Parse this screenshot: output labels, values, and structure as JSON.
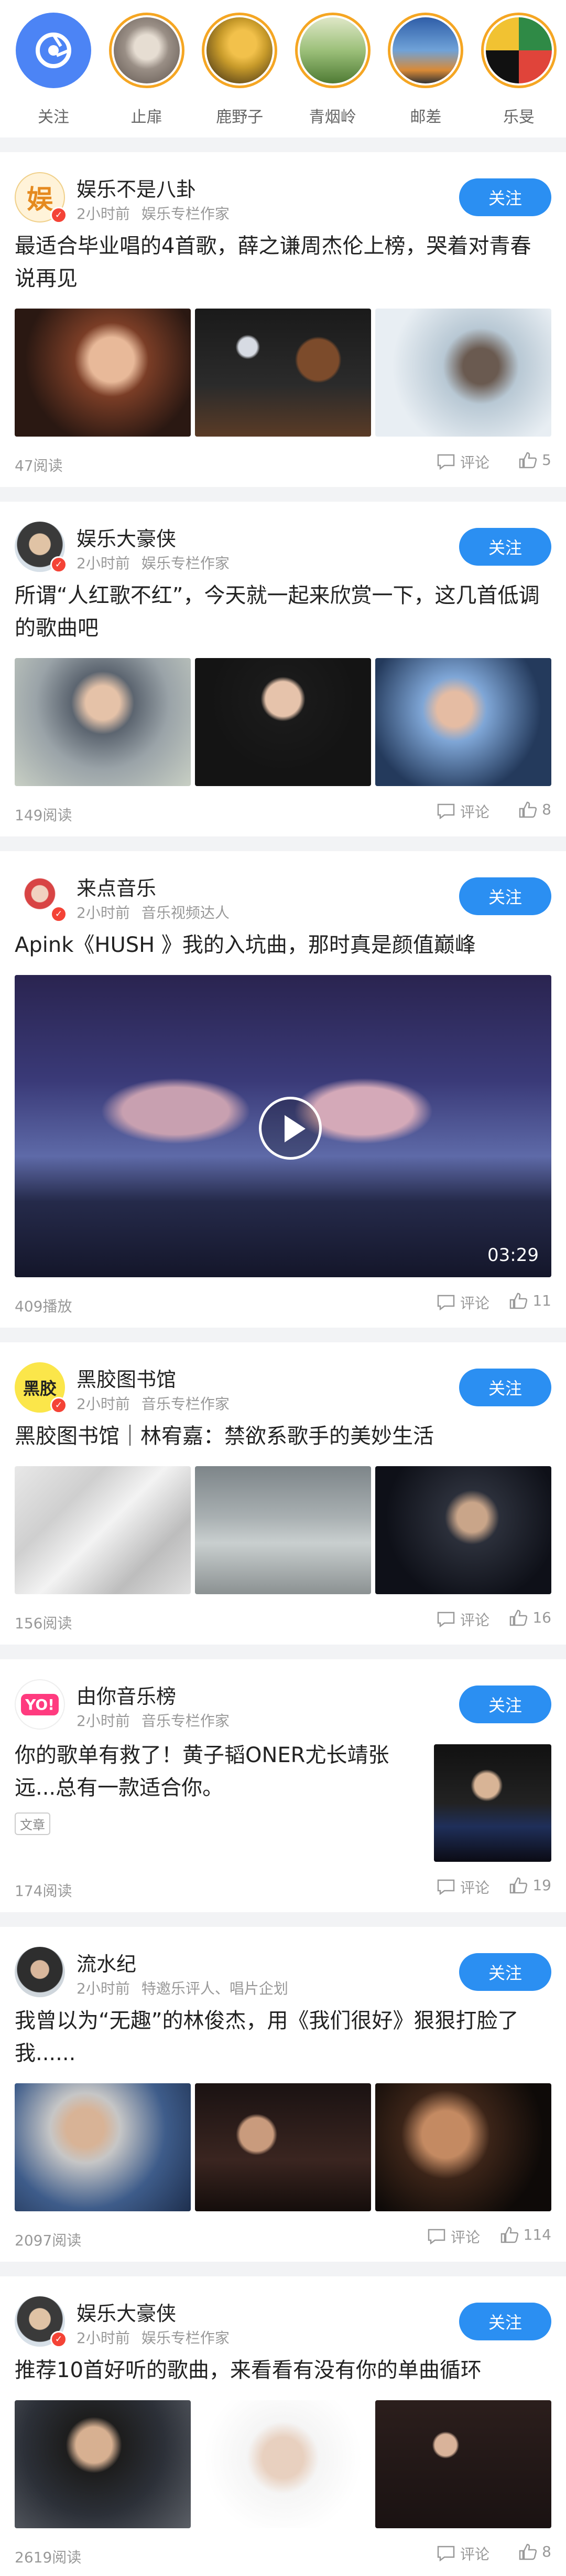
{
  "stories": [
    {
      "name": "关注",
      "kind": "follow"
    },
    {
      "name": "止扉",
      "kind": "avatar",
      "color": "#9a8f86"
    },
    {
      "name": "鹿野子",
      "kind": "avatar",
      "color": "#c79a2a"
    },
    {
      "name": "青烟岭",
      "kind": "avatar",
      "color": "#6fa057"
    },
    {
      "name": "邮差",
      "kind": "avatar",
      "color": "#3b6fb2"
    },
    {
      "name": "乐旻",
      "kind": "avatar",
      "color": "#2f8a46"
    }
  ],
  "cards": [
    {
      "author": "娱乐不是八卦",
      "time": "2小时前",
      "role": "娱乐专栏作家",
      "follow": "关注",
      "title": "最适合毕业唱的4首歌，薛之谦周杰伦上榜，哭着对青春说再见",
      "count": "47阅读",
      "comment": "评论",
      "likes": "5"
    },
    {
      "author": "娱乐大豪侠",
      "time": "2小时前",
      "role": "娱乐专栏作家",
      "follow": "关注",
      "title": "所谓“人红歌不红”，今天就一起来欣赏一下，这几首低调的歌曲吧",
      "count": "149阅读",
      "comment": "评论",
      "likes": "8"
    },
    {
      "author": "来点音乐",
      "time": "2小时前",
      "role": "音乐视频达人",
      "follow": "关注",
      "title": "Apink《HUSH 》我的入坑曲，那时真是颜值巅峰",
      "duration": "03:29",
      "count": "409播放",
      "comment": "评论",
      "likes": "11"
    },
    {
      "author": "黑胶图书馆",
      "time": "2小时前",
      "role": "音乐专栏作家",
      "follow": "关注",
      "title": "黑胶图书馆｜林宥嘉：禁欲系歌手的美妙生活",
      "count": "156阅读",
      "comment": "评论",
      "likes": "16"
    },
    {
      "author": "由你音乐榜",
      "time": "2小时前",
      "role": "音乐专栏作家",
      "follow": "关注",
      "title": "你的歌单有救了！黄子韬ONER尤长靖张远...总有一款适合你。",
      "tag": "文章",
      "count": "174阅读",
      "comment": "评论",
      "likes": "19"
    },
    {
      "author": "流水纪",
      "time": "2小时前",
      "role": "特邀乐评人、唱片企划",
      "follow": "关注",
      "title": "我曾以为“无趣”的林俊杰，用《我们很好》狠狠打脸了我......",
      "count": "2097阅读",
      "comment": "评论",
      "likes": "114"
    },
    {
      "author": "娱乐大豪侠",
      "time": "2小时前",
      "role": "娱乐专栏作家",
      "follow": "关注",
      "title": "推荐10首好听的歌曲，来看看有没有你的单曲循环",
      "count": "2619阅读",
      "comment": "评论",
      "likes": "8"
    }
  ],
  "logo_texts": {
    "card1": "娱",
    "card4": "黑胶",
    "card5": "YO!"
  },
  "colors": {
    "accent": "#2b8ff2",
    "story_ring": "#f5a623",
    "badge": "#f44336"
  }
}
